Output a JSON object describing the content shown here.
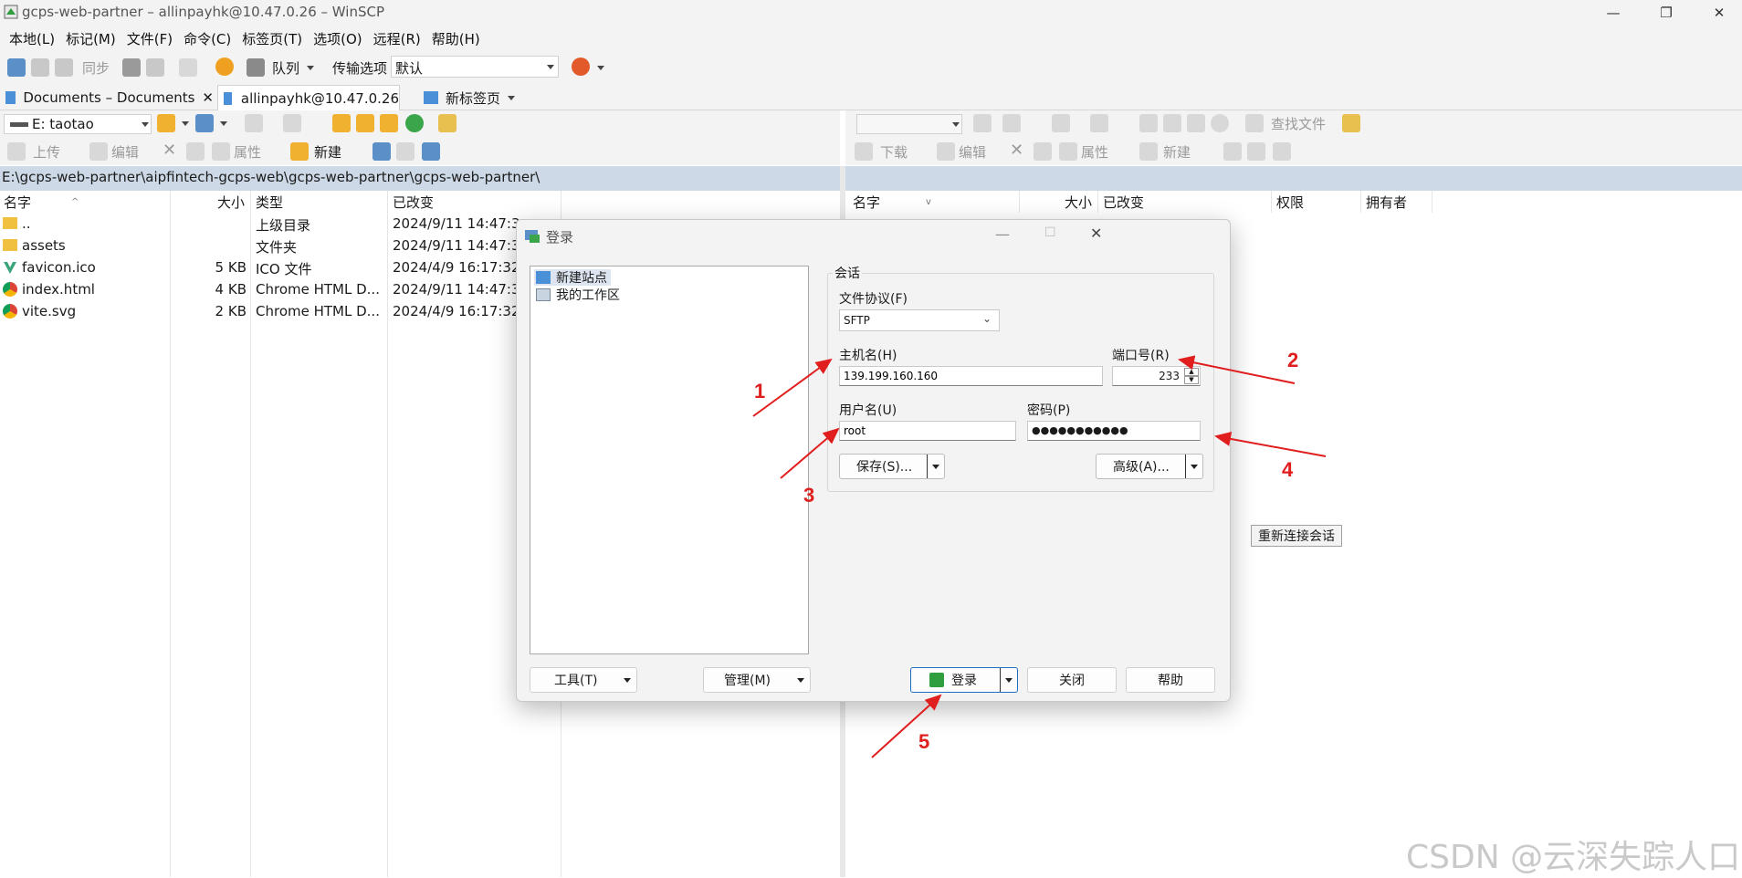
{
  "window": {
    "title": "gcps-web-partner – allinpayhk@10.47.0.26 – WinSCP",
    "minimize": "—",
    "restore": "❐",
    "close": "✕"
  },
  "menu": [
    "本地(L)",
    "标记(M)",
    "文件(F)",
    "命令(C)",
    "标签页(T)",
    "选项(O)",
    "远程(R)",
    "帮助(H)"
  ],
  "toolbar": {
    "sync_label": "同步",
    "queue_label": "队列",
    "transfer_options_label": "传输选项",
    "transfer_preset_value": "默认"
  },
  "tabs": [
    {
      "label": "Documents – Documents",
      "close": "✕"
    },
    {
      "label": "allinpayhk@10.47.0.26"
    },
    {
      "label": "新标签页"
    }
  ],
  "local": {
    "drive_value": "E: taotao",
    "upload_label": "上传",
    "edit_label": "编辑",
    "properties_label": "属性",
    "new_label": "新建",
    "path": "E:\\gcps-web-partner\\aipfintech-gcps-web\\gcps-web-partner\\gcps-web-partner\\",
    "columns": [
      "名字",
      "大小",
      "类型",
      "已改变"
    ],
    "files": [
      {
        "name": "..",
        "size": "",
        "type": "上级目录",
        "modified": "2024/9/11 14:47:3"
      },
      {
        "name": "assets",
        "size": "",
        "type": "文件夹",
        "modified": "2024/9/11 14:47:3"
      },
      {
        "name": "favicon.ico",
        "size": "5 KB",
        "type": "ICO 文件",
        "modified": "2024/4/9 16:17:32"
      },
      {
        "name": "index.html",
        "size": "4 KB",
        "type": "Chrome HTML D...",
        "modified": "2024/9/11 14:47:3"
      },
      {
        "name": "vite.svg",
        "size": "2 KB",
        "type": "Chrome HTML D...",
        "modified": "2024/4/9 16:17:32"
      }
    ]
  },
  "remote": {
    "find_files_label": "查找文件",
    "download_label": "下载",
    "edit_label": "编辑",
    "properties_label": "属性",
    "new_label": "新建",
    "columns": [
      "名字",
      "大小",
      "已改变",
      "权限",
      "拥有者"
    ],
    "reconnect_label": "重新连接会话"
  },
  "dialog": {
    "title": "登录",
    "tree": [
      "新建站点",
      "我的工作区"
    ],
    "session_group": "会话",
    "protocol_label": "文件协议(F)",
    "protocol_value": "SFTP",
    "host_label": "主机名(H)",
    "host_value": "139.199.160.160",
    "port_label": "端口号(R)",
    "port_value": "233",
    "user_label": "用户名(U)",
    "user_value": "root",
    "password_label": "密码(P)",
    "password_value": "●●●●●●●●●●●",
    "save_button": "保存(S)...",
    "advanced_button": "高级(A)...",
    "tools_button": "工具(T)",
    "manage_button": "管理(M)",
    "login_button": "登录",
    "close_button": "关闭",
    "help_button": "帮助"
  },
  "annotations": [
    "1",
    "2",
    "3",
    "4",
    "5"
  ],
  "watermark": "CSDN @云深失踪人口",
  "colors": {
    "annotation": "#e01e1e",
    "pathbar": "#cdd9e6",
    "login_icon": "#2e9e3e"
  }
}
